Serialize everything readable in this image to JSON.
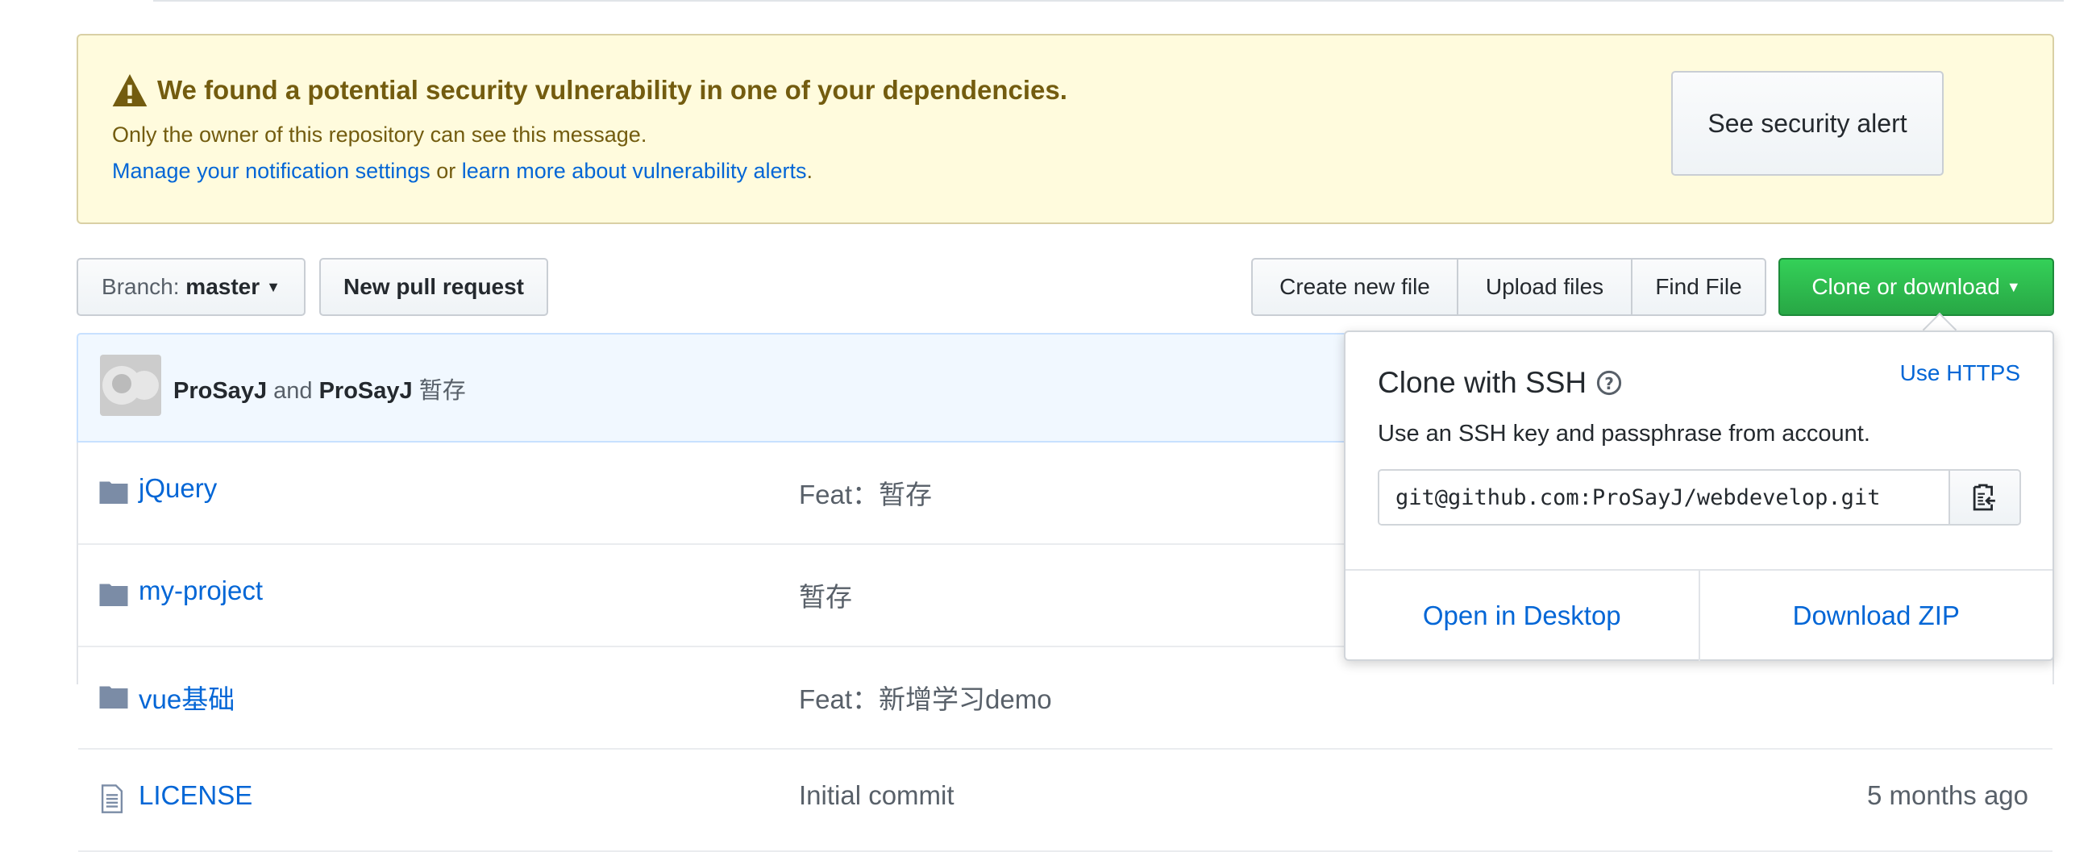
{
  "alert": {
    "title": "We found a potential security vulnerability in one of your dependencies.",
    "text": "Only the owner of this repository can see this message.",
    "link1": "Manage your notification settings",
    "or": " or ",
    "link2": "learn more about vulnerability alerts",
    "period": ".",
    "button": "See security alert"
  },
  "toolbar": {
    "branch_label": "Branch:",
    "branch": "master",
    "new_pr": "New pull request",
    "create_file": "Create new file",
    "upload": "Upload files",
    "find": "Find File",
    "clone": "Clone or download"
  },
  "commit": {
    "author1": "ProSayJ",
    "and": "and",
    "author2": "ProSayJ",
    "message": "暂存"
  },
  "files": [
    {
      "type": "folder",
      "name": "jQuery",
      "message": "Feat：暂存",
      "age": ""
    },
    {
      "type": "folder",
      "name": "my-project",
      "message": "暂存",
      "age": ""
    },
    {
      "type": "folder",
      "name": "vue基础",
      "message": "Feat：新增学习demo",
      "age": ""
    },
    {
      "type": "file",
      "name": "LICENSE",
      "message": "Initial commit",
      "age": "5 months ago"
    }
  ],
  "clone_popup": {
    "title": "Clone with SSH",
    "switch": "Use HTTPS",
    "description": "Use an SSH key and passphrase from account.",
    "url": "git@github.com:ProSayJ/webdevelop.git",
    "open_desktop": "Open in Desktop",
    "download_zip": "Download ZIP"
  },
  "colors": {
    "primary": "#2ea44f",
    "link": "#0366d6",
    "alert_bg": "#fffbdd",
    "alert_text": "#735c0f"
  }
}
